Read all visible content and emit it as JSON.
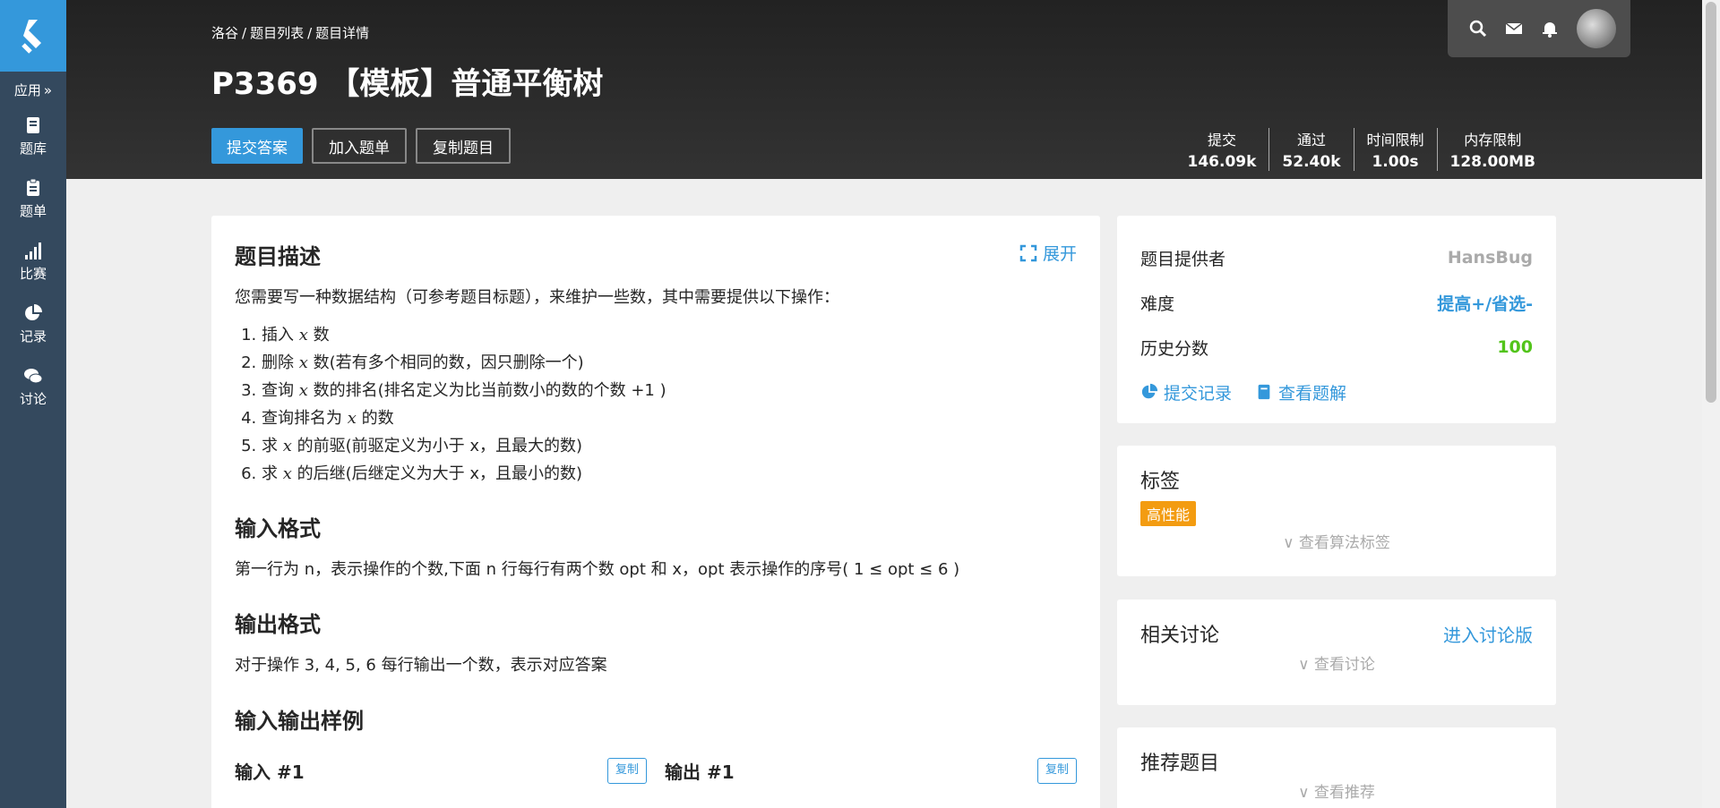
{
  "sidebar": {
    "app_label": "应用",
    "items": [
      {
        "label": "题库",
        "icon": "book-icon"
      },
      {
        "label": "题单",
        "icon": "clipboard-icon"
      },
      {
        "label": "比赛",
        "icon": "bar-chart-icon"
      },
      {
        "label": "记录",
        "icon": "pie-chart-icon"
      },
      {
        "label": "讨论",
        "icon": "chat-icon"
      }
    ]
  },
  "header": {
    "breadcrumb": [
      "洛谷",
      "题目列表",
      "题目详情"
    ],
    "title": "P3369 【模板】普通平衡树",
    "buttons": {
      "submit": "提交答案",
      "add_list": "加入题单",
      "copy": "复制题目"
    },
    "stats": [
      {
        "label": "提交",
        "value": "146.09k"
      },
      {
        "label": "通过",
        "value": "52.40k"
      },
      {
        "label": "时间限制",
        "value": "1.00s"
      },
      {
        "label": "内存限制",
        "value": "128.00MB"
      }
    ]
  },
  "problem": {
    "desc_title": "题目描述",
    "expand": "展开",
    "intro": "您需要写一种数据结构（可参考题目标题），来维护一些数，其中需要提供以下操作：",
    "ops": [
      [
        "插入 ",
        "x",
        " 数"
      ],
      [
        "删除 ",
        "x",
        " 数(若有多个相同的数，因只删除一个)"
      ],
      [
        "查询 ",
        "x",
        " 数的排名(排名定义为比当前数小的数的个数 +1 )"
      ],
      [
        "查询排名为 ",
        "x",
        " 的数"
      ],
      [
        "求 ",
        "x",
        " 的前驱(前驱定义为小于 x，且最大的数)"
      ],
      [
        "求 ",
        "x",
        " 的后继(后继定义为大于 x，且最小的数)"
      ]
    ],
    "input_title": "输入格式",
    "input_text": "第一行为 n，表示操作的个数,下面 n 行每行有两个数 opt 和 x，opt 表示操作的序号( 1 ≤ opt ≤ 6 )",
    "output_title": "输出格式",
    "output_text": "对于操作 3, 4, 5, 6 每行输出一个数，表示对应答案",
    "sample_title": "输入输出样例",
    "sample_in": "输入 #1",
    "sample_out": "输出 #1",
    "copy": "复制"
  },
  "info": {
    "provider_label": "题目提供者",
    "provider": "HansBug",
    "difficulty_label": "难度",
    "difficulty": "提高+/省选-",
    "score_label": "历史分数",
    "score": "100",
    "record_link": "提交记录",
    "solution_link": "查看题解"
  },
  "tags": {
    "title": "标签",
    "tag": "高性能",
    "more": "查看算法标签"
  },
  "discuss": {
    "title": "相关讨论",
    "link": "进入讨论版",
    "more": "查看讨论"
  },
  "recommend": {
    "title": "推荐题目",
    "more": "查看推荐"
  },
  "colors": {
    "accent": "#3498db",
    "sidebar": "#34495e",
    "tag": "#f39c11",
    "score": "#52c41a"
  }
}
